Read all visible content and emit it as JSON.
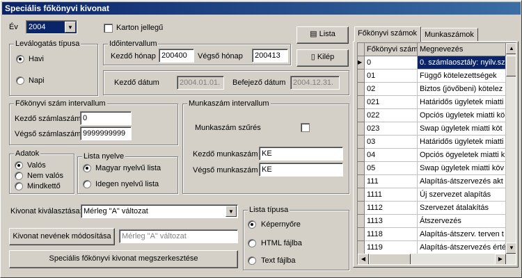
{
  "window": {
    "title": "Speciális főkönyvi kivonat"
  },
  "year": {
    "label": "Év",
    "value": "2004"
  },
  "karton": {
    "label": "Karton jellegű",
    "checked": false
  },
  "buttons": {
    "lista": "Lista",
    "kilep": "Kilép",
    "rename": "Kivonat nevének módosítása",
    "build": "Speciális főkönyvi kivonat megszerkesztése"
  },
  "levalogatas": {
    "title": "Leválogatás típusa",
    "options": [
      "Havi",
      "Napi"
    ],
    "selected": 0
  },
  "idointervallum": {
    "title": "Időintervallum",
    "start_month_label": "Kezdő hónap",
    "start_month": "200400",
    "end_month_label": "Végső hónap",
    "end_month": "200413",
    "start_date_label": "Kezdő dátum",
    "start_date": "2004.01.01.",
    "end_date_label": "Befejező dátum",
    "end_date": "2004.12.31."
  },
  "fokonyvi_interval": {
    "title": "Főkönyvi szám intervallum",
    "start_label": "Kezdő számlaszám",
    "start": "0",
    "end_label": "Végső számlaszám",
    "end": "9999999999"
  },
  "munkaszam_interval": {
    "title": "Munkaszám intervallum",
    "filter_label": "Munkaszám szűrés",
    "filter_checked": false,
    "start_label": "Kezdő munkaszám",
    "start": "KE",
    "end_label": "Végső munkaszám",
    "end": "KE"
  },
  "adatok": {
    "title": "Adatok",
    "options": [
      "Valós",
      "Nem valós",
      "Mindkettő"
    ],
    "selected": 0
  },
  "lista_nyelve": {
    "title": "Lista nyelve",
    "options": [
      "Magyar nyelvű lista",
      "Idegen nyelvű lista"
    ],
    "selected": 0
  },
  "kivonat": {
    "label": "Kivonat kiválasztása:",
    "selected": "Mérleg \"A\" változat",
    "rename_value": "Mérleg \"A\" változat"
  },
  "lista_tipusa": {
    "title": "Lista típusa",
    "options": [
      "Képernyőre",
      "HTML fájlba",
      "Text fájlba"
    ],
    "selected": 0
  },
  "tabs": [
    "Főkönyvi számok",
    "Munkaszámok"
  ],
  "grid": {
    "columns": [
      "Főkönyvi szám",
      "Megnevezés"
    ],
    "rows": [
      [
        "0",
        "0. számlaosztály: nyilv.sz"
      ],
      [
        "01",
        "Függő kötelezettségek"
      ],
      [
        "02",
        "Biztos (jövőbeni) kötelez"
      ],
      [
        "021",
        "Határidős ügyletek miatti"
      ],
      [
        "022",
        "Opciós ügyletek miatti kö"
      ],
      [
        "023",
        "Swap ügyletek miatti köt"
      ],
      [
        "03",
        "Határidős ügyletek miatti"
      ],
      [
        "04",
        "Opciós ögyeletek miatti k"
      ],
      [
        "05",
        "Swap ügyletek miatti köv"
      ],
      [
        "111",
        "Alapítás-átszervezés akt"
      ],
      [
        "1111",
        "Új szervezet alapítás"
      ],
      [
        "1112",
        "Szervezet átalakítás"
      ],
      [
        "1113",
        "Átszervezés"
      ],
      [
        "1118",
        "Alapítás-átszerv. terven t"
      ],
      [
        "1119",
        "Alapítás-átszervezés érté"
      ]
    ],
    "selected_row": 0
  }
}
